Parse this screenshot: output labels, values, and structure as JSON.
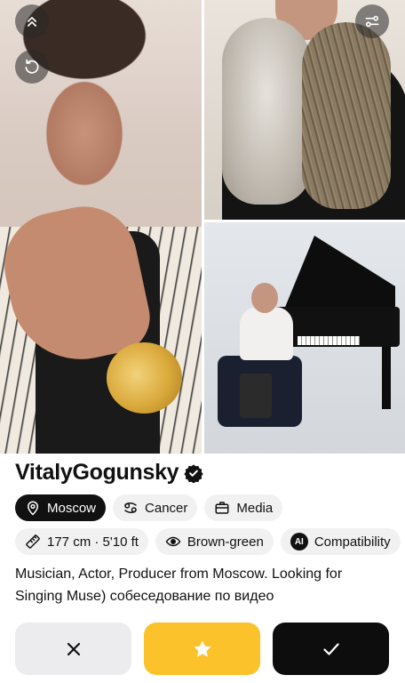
{
  "profile": {
    "name": "VitalyGogunsky",
    "verified": true,
    "bio": "Musician, Actor, Producer from Moscow. Looking for Singing Muse) собеседование по видео"
  },
  "chips_row1": [
    {
      "label": "Moscow",
      "icon": "location-pin-icon",
      "selected": true
    },
    {
      "label": "Cancer",
      "icon": "cancer-zodiac-icon",
      "selected": false
    },
    {
      "label": "Media",
      "icon": "briefcase-icon",
      "selected": false
    }
  ],
  "chips_row2": [
    {
      "label": "177 cm · 5'10 ft",
      "icon": "ruler-icon"
    },
    {
      "label": "Brown-green",
      "icon": "eye-icon"
    },
    {
      "label": "Compatibility",
      "icon": "ai-badge-icon",
      "badge": "AI"
    }
  ],
  "overlay": {
    "collapse_icon": "double-chevron-up-icon",
    "undo_icon": "undo-icon",
    "filter_icon": "filter-sliders-icon"
  },
  "actions": {
    "dislike_icon": "close-icon",
    "super_icon": "star-icon",
    "like_icon": "checkmark-icon"
  },
  "colors": {
    "accent_yellow": "#fcc22b",
    "dark": "#0d0d0d",
    "chip_bg": "#f1f1f1"
  }
}
